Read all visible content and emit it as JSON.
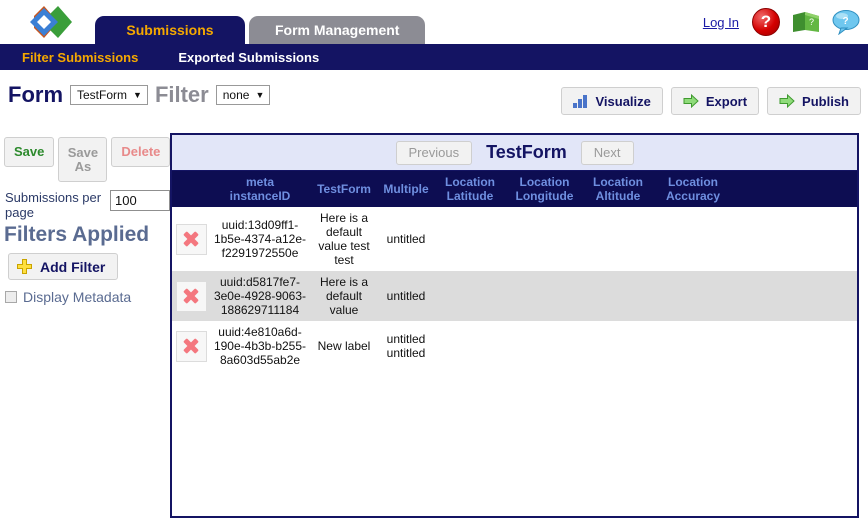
{
  "colors": {
    "navy": "#141463",
    "header_navy": "#0d0d52",
    "gold": "#f5a800",
    "gray_tab": "#8c8c94",
    "panel_top": "#e2e6f8",
    "header_text": "#6f8fe0",
    "alt_row": "#dcdcdc",
    "delete_red": "#f4777f",
    "save_green": "#2d8a2d"
  },
  "header": {
    "logo_name": "odk-logo",
    "tabs": [
      {
        "label": "Submissions",
        "active": true
      },
      {
        "label": "Form Management",
        "active": false
      }
    ],
    "login_label": "Log In",
    "icons": [
      {
        "name": "help-circle-icon",
        "glyph": "?"
      },
      {
        "name": "book-icon",
        "glyph": "?"
      },
      {
        "name": "chat-bubble-icon",
        "glyph": "?"
      }
    ]
  },
  "subnav": {
    "items": [
      {
        "label": "Filter Submissions",
        "active": true
      },
      {
        "label": "Exported Submissions",
        "active": false
      }
    ]
  },
  "toolbar": {
    "form_label": "Form",
    "form_select_value": "TestForm",
    "filter_label": "Filter",
    "filter_select_value": "none",
    "caret": "▼",
    "actions": [
      {
        "label": "Visualize",
        "icon": "bar-chart-icon"
      },
      {
        "label": "Export",
        "icon": "green-arrow-icon"
      },
      {
        "label": "Publish",
        "icon": "green-arrow-icon"
      }
    ]
  },
  "sidebar": {
    "save_label": "Save",
    "save_as_label": "Save As",
    "delete_label": "Delete",
    "per_page_label": "Submissions per page",
    "per_page_value": "100",
    "filters_applied_title": "Filters Applied",
    "add_filter_label": "Add Filter",
    "display_metadata_label": "Display Metadata",
    "display_metadata_checked": false
  },
  "panel": {
    "previous_label": "Previous",
    "previous_disabled": true,
    "next_label": "Next",
    "next_disabled": true,
    "title": "TestForm",
    "columns": [
      {
        "key": "delete",
        "label": ""
      },
      {
        "key": "instance_id",
        "label": "meta\ninstanceID"
      },
      {
        "key": "testform",
        "label": "TestForm"
      },
      {
        "key": "multiple",
        "label": "Multiple"
      },
      {
        "key": "lat",
        "label": "Location\nLatitude"
      },
      {
        "key": "lon",
        "label": "Location\nLongitude"
      },
      {
        "key": "alt",
        "label": "Location\nAltitude"
      },
      {
        "key": "acc",
        "label": "Location\nAccuracy"
      }
    ],
    "rows": [
      {
        "instance_id": "uuid:13d09ff1-1b5e-4374-a12e-f2291972550e",
        "testform": "Here is a default value test test",
        "multiple": "untitled",
        "lat": "",
        "lon": "",
        "alt": "",
        "acc": ""
      },
      {
        "instance_id": "uuid:d5817fe7-3e0e-4928-9063-188629711184",
        "testform": "Here is a default value",
        "multiple": "untitled",
        "lat": "",
        "lon": "",
        "alt": "",
        "acc": ""
      },
      {
        "instance_id": "uuid:4e810a6d-190e-4b3b-b255-8a603d55ab2e",
        "testform": "New label",
        "multiple": "untitled\nuntitled",
        "lat": "",
        "lon": "",
        "alt": "",
        "acc": ""
      }
    ]
  }
}
